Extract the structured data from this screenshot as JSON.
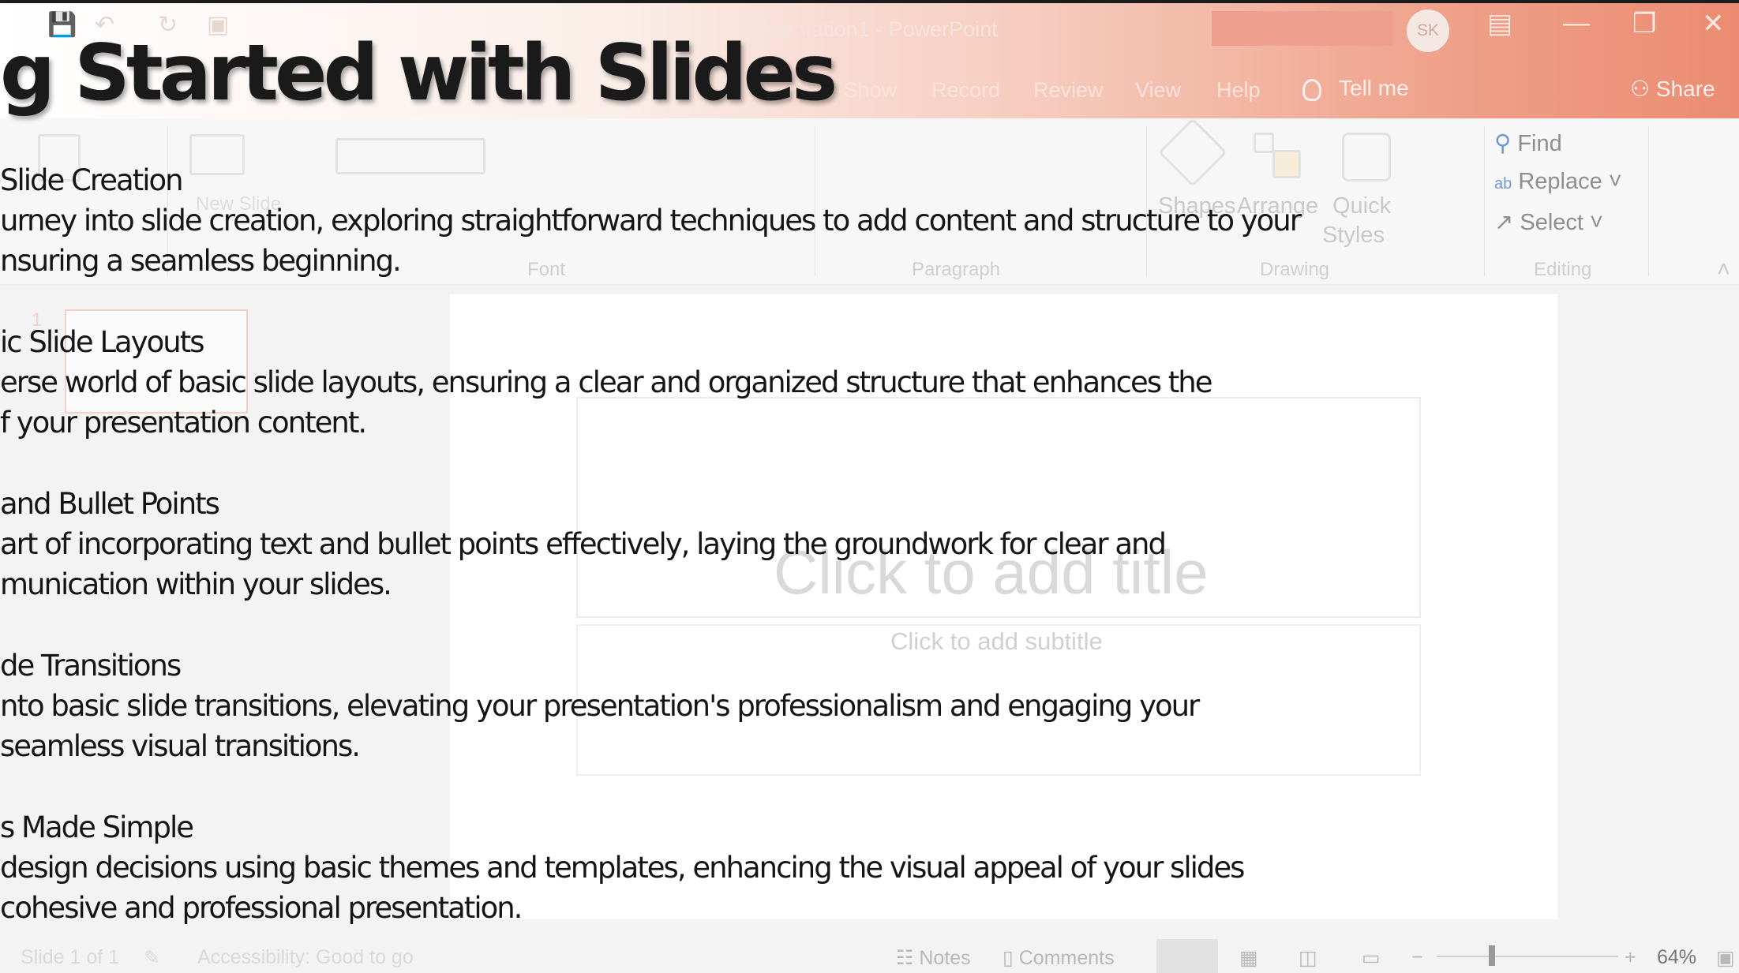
{
  "app": {
    "document_title": "Presentation1  -  PowerPoint",
    "user_initials": "SK",
    "tabs": [
      "ations",
      "Slide Show",
      "Record",
      "Review",
      "View",
      "Help"
    ],
    "tell_me": "Tell me",
    "share": "Share"
  },
  "ribbon": {
    "new_slide": "New Slide",
    "group_labels": [
      "Font",
      "Paragraph",
      "Drawing",
      "Editing"
    ],
    "drawing": {
      "shapes": "Shapes",
      "arrange": "Arrange",
      "quick_styles_1": "Quick",
      "quick_styles_2": "Styles"
    },
    "editing": {
      "find": "Find",
      "replace": "Replace",
      "select": "Select"
    }
  },
  "slide": {
    "number": "1",
    "title_placeholder": "Click to add title",
    "subtitle_placeholder": "Click to add subtitle"
  },
  "statusbar": {
    "slide_count": "Slide 1 of 1",
    "accessibility": "Accessibility: Good to go",
    "notes": "Notes",
    "comments": "Comments",
    "zoom": "64%"
  },
  "overlay": {
    "title": "g Started with Slides",
    "sections": [
      {
        "heading": "Slide Creation",
        "lines": [
          "urney into slide creation, exploring straightforward techniques to add content and structure to your",
          "nsuring a seamless beginning."
        ]
      },
      {
        "heading": "ic Slide Layouts",
        "lines": [
          "erse world of basic slide layouts, ensuring a clear and organized structure that enhances the",
          "f your presentation content."
        ]
      },
      {
        "heading": " and Bullet Points",
        "lines": [
          "art of incorporating text and bullet points effectively, laying the groundwork for clear and",
          "munication within your slides."
        ]
      },
      {
        "heading": "de Transitions",
        "lines": [
          "nto basic slide transitions, elevating your presentation's professionalism and engaging your",
          "seamless visual transitions."
        ]
      },
      {
        "heading": "s Made Simple",
        "lines": [
          " design decisions using basic themes and templates, enhancing the visual appeal of your slides",
          " cohesive and professional presentation."
        ]
      }
    ]
  }
}
